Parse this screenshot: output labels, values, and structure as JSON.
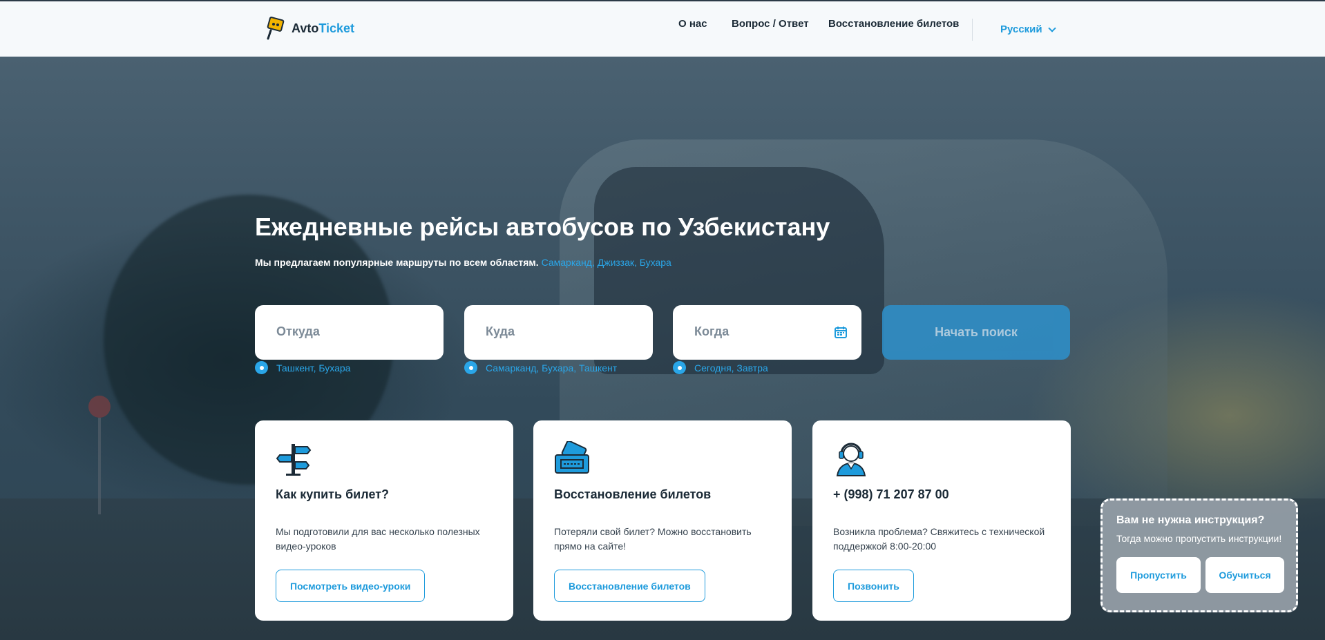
{
  "brand": {
    "name_part1": "Avto",
    "name_part2": "Ticket",
    "accent_color": "#1e9bdc"
  },
  "nav": {
    "items": [
      {
        "label": "О нас"
      },
      {
        "label": "Вопрос / Ответ"
      },
      {
        "label": "Восстановление билетов"
      }
    ],
    "language": "Русский"
  },
  "hero": {
    "title": "Ежедневные рейсы автобусов по Узбекистану",
    "subtitle": "Мы предлагаем популярные маршруты по всем областям.",
    "subtitle_links": "Самарканд, Джиззак, Бухара"
  },
  "search": {
    "from_placeholder": "Откуда",
    "to_placeholder": "Куда",
    "when_placeholder": "Когда",
    "submit_label": "Начать поиск",
    "from_hint": "Ташкент, Бухара",
    "to_hint": "Самарканд, Бухара, Ташкент",
    "when_hint": "Сегодня, Завтра"
  },
  "cards": [
    {
      "icon": "signpost-icon",
      "title": "Как купить билет?",
      "description": "Мы подготовили для вас несколько полезных видео-уроков",
      "button": "Посмотреть видео-уроки"
    },
    {
      "icon": "ticket-icon",
      "title": "Восстановление билетов",
      "description": "Потеряли свой билет? Можно восстановить прямо на сайте!",
      "button": "Восстановление билетов"
    },
    {
      "icon": "support-agent-icon",
      "title": "+ (998) 71 207 87 00",
      "description": "Возникла проблема? Свяжитесь с технической поддержкой 8:00-20:00",
      "button": "Позвонить"
    }
  ],
  "tutorial_popup": {
    "title": "Вам не нужна инструкция?",
    "subtitle": "Тогда можно пропустить инструкции!",
    "skip_label": "Пропустить",
    "learn_label": "Обучиться"
  }
}
